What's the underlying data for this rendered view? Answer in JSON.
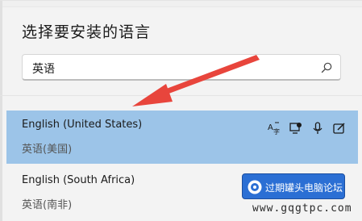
{
  "dialog": {
    "title": "选择要安装的语言"
  },
  "search": {
    "value": "英语",
    "icon": "search-icon"
  },
  "languages": [
    {
      "name": "English (United States)",
      "native": "英语(美国)",
      "selected": true,
      "features": [
        "display-language-icon",
        "text-to-speech-icon",
        "speech-recognition-icon",
        "handwriting-icon"
      ]
    },
    {
      "name": "English (South Africa)",
      "native": "英语(南非)",
      "selected": false,
      "features": [
        "text-to-speech-icon",
        "handwriting-icon"
      ]
    }
  ],
  "annotation": {
    "arrow_color": "#e8453c"
  },
  "watermark": {
    "label": "过期罐头电脑论坛",
    "url": "www.gqgtpc.com",
    "color": "#2b6fd4"
  },
  "colors": {
    "selected_row": "#9cc4e8",
    "background": "#f3f3f3"
  }
}
